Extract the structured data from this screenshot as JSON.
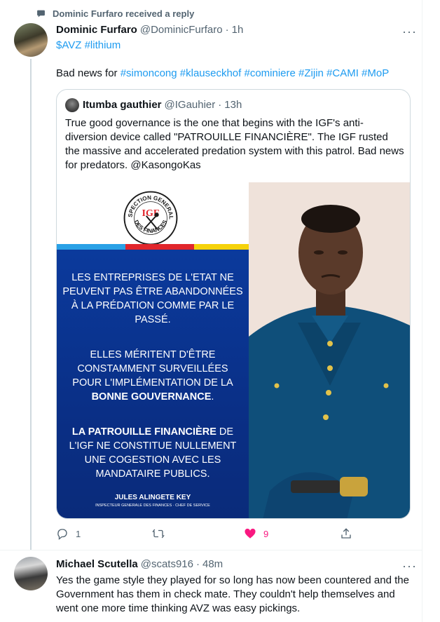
{
  "context": {
    "text": "Dominic Furfaro received a reply",
    "icon": "speech-bubble-icon"
  },
  "tweet": {
    "name": "Dominic Furfaro",
    "handle": "@DominicFurfaro",
    "dot": "·",
    "time": "1h",
    "tickers": "$AVZ #lithium",
    "body_prefix": "Bad news for ",
    "hashtags": "#simoncong #klauseckhof #cominiere #Zijin #CAMI #MoP"
  },
  "quote": {
    "name": "Itumba gauthier",
    "handle": "@IGauhier",
    "dot": "·",
    "time": "13h",
    "text": "True good governance is the one that begins with the IGF's anti-diversion device called \"PATROUILLE FINANCIÈRE\". The IGF rusted the massive and accelerated predation system with this patrol. Bad news for predators. @KasongoKas",
    "poster": {
      "seal_top": "INSPECTION GENERALE",
      "seal_bottom": "DES FINANCES",
      "seal_mark": "IGF",
      "para1": "LES ENTREPRISES DE L'ETAT NE PEUVENT PAS ÊTRE ABANDONNÉES À LA PRÉDATION COMME PAR LE PASSÉ.",
      "para2_plain": "ELLES MÉRITENT D'ÊTRE CONSTAMMENT SURVEILLÉES POUR L'IMPLÉMENTATION DE LA ",
      "para2_bold": "BONNE GOUVERNANCE",
      "para2_end": ".",
      "para3_bold": "LA PATROUILLE FINANCIÈRE",
      "para3_plain": "DE L'IGF NE CONSTITUE NULLEMENT UNE COGESTION AVEC LES MANDATAIRE PUBLICS.",
      "signature_name": "JULES ALINGETE KEY",
      "signature_title": "INSPECTEUR GENERALE DES FINANCES · CHEF DE SERVICE"
    },
    "flag_colors": [
      "#2aa1e6",
      "#e1262c",
      "#f5d20b"
    ]
  },
  "actions": {
    "reply": {
      "icon": "reply-icon",
      "count": "1"
    },
    "retweet": {
      "icon": "retweet-icon",
      "count": ""
    },
    "like": {
      "icon": "heart-icon",
      "count": "9",
      "color": "#f91880"
    },
    "share": {
      "icon": "share-icon"
    }
  },
  "reply": {
    "name": "Michael Scutella",
    "handle": "@scats916",
    "dot": "·",
    "time": "48m",
    "text": "Yes the game style they played for so long has now been countered and the Government has them in check mate. They couldn't help themselves and went one more time thinking AVZ was easy pickings."
  },
  "colors": {
    "link": "#1d9bf0",
    "secondary_text": "#536471",
    "border": "#cfd9de",
    "poster_blue": "#0b3a9c"
  }
}
